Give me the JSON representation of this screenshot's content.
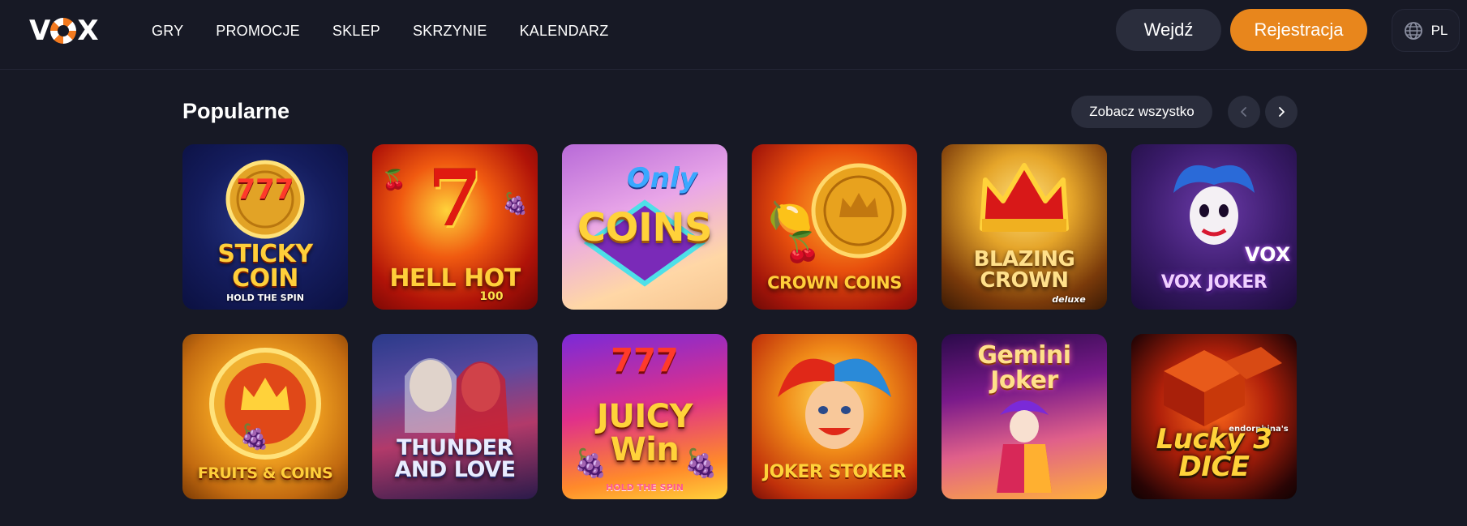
{
  "brand": {
    "logo_text_left": "V",
    "logo_text_right": "X",
    "accent": "#e8861c",
    "background": "#171925"
  },
  "nav": {
    "items": [
      {
        "label": "GRY"
      },
      {
        "label": "PROMOCJE"
      },
      {
        "label": "SKLEP"
      },
      {
        "label": "SKRZYNIE"
      },
      {
        "label": "KALENDARZ"
      }
    ]
  },
  "header": {
    "login_label": "Wejdź",
    "register_label": "Rejestracja",
    "language": {
      "label": "PL",
      "icon": "globe-icon"
    }
  },
  "section": {
    "title": "Popularne",
    "see_all_label": "Zobacz wszystko",
    "prev_icon": "chevron-left-icon",
    "next_icon": "chevron-right-icon"
  },
  "games": [
    {
      "title": "STICKY COIN",
      "subtitle": "HOLD THE SPIN",
      "badge": "777",
      "title_color": "#ffcf3a"
    },
    {
      "title": "HELL HOT",
      "subtitle": "100",
      "badge": "7",
      "title_color": "#ffcf3a"
    },
    {
      "title": "COINS",
      "subtitle": "",
      "badge": "Only",
      "title_color": "#ffd23a"
    },
    {
      "title": "CROWN COINS",
      "subtitle": "",
      "badge": "",
      "title_color": "#ffcf3a"
    },
    {
      "title": "BLAZING CROWN",
      "subtitle": "deluxe",
      "badge": "",
      "title_color": "#ffe08a"
    },
    {
      "title": "VOX JOKER",
      "subtitle": "",
      "badge": "VOX",
      "title_color": "#f0d0ff"
    },
    {
      "title": "FRUITS & COINS",
      "subtitle": "",
      "badge": "",
      "title_color": "#ffcf3a"
    },
    {
      "title": "THUNDER AND LOVE",
      "subtitle": "",
      "badge": "",
      "title_color": "#e8ecff"
    },
    {
      "title": "JUICY Win",
      "subtitle": "HOLD THE SPIN",
      "badge": "777",
      "title_color": "#ffd23a"
    },
    {
      "title": "JOKER STOKER",
      "subtitle": "",
      "badge": "",
      "title_color": "#ffd23a"
    },
    {
      "title": "Gemini Joker",
      "subtitle": "",
      "badge": "",
      "title_color": "#ffe08a"
    },
    {
      "title": "Lucky 3 DICE",
      "subtitle": "endorphina's",
      "badge": "",
      "title_color": "#ffd23a"
    }
  ]
}
